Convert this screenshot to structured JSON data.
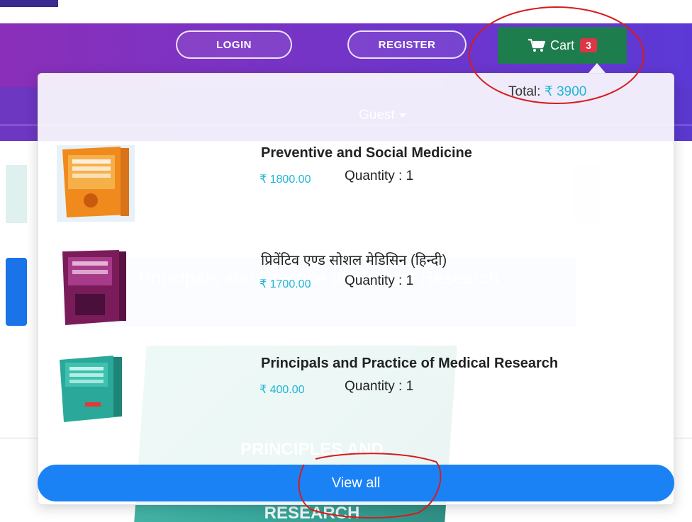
{
  "header": {
    "login_label": "LOGIN",
    "register_label": "REGISTER",
    "cart_label": "Cart",
    "cart_count": "3",
    "user_menu_label": "Guest"
  },
  "cart_dropdown": {
    "total_label": "Total:",
    "total_value": "₹ 3900",
    "items": [
      {
        "title": "Preventive and Social Medicine",
        "price": "₹ 1800.00",
        "quantity": "Quantity : 1"
      },
      {
        "title": "प्रिवेंटिव एण्ड सोशल मेडिसिन (हिन्दी)",
        "price": "₹ 1700.00",
        "quantity": "Quantity : 1"
      },
      {
        "title": "Principals and Practice of Medical Research",
        "price": "₹ 400.00",
        "quantity": "Quantity : 1"
      }
    ],
    "view_all_label": "View all"
  },
  "background_page": {
    "card_title": "Principals and Practice of Medical Research",
    "book_cover_text": "PRINCIPLES AND PRACTICE MEDICAL RESEARCH"
  },
  "colors": {
    "header_purple": "#7a33c4",
    "cart_green": "#1e7d4d",
    "badge_red": "#dc3545",
    "price_cyan": "#1fb5d6",
    "view_all_blue": "#1a82f5",
    "annotation_red": "#d81b1b"
  },
  "icons": {
    "cart": "shopping-cart-icon",
    "caret": "caret-down-icon"
  }
}
